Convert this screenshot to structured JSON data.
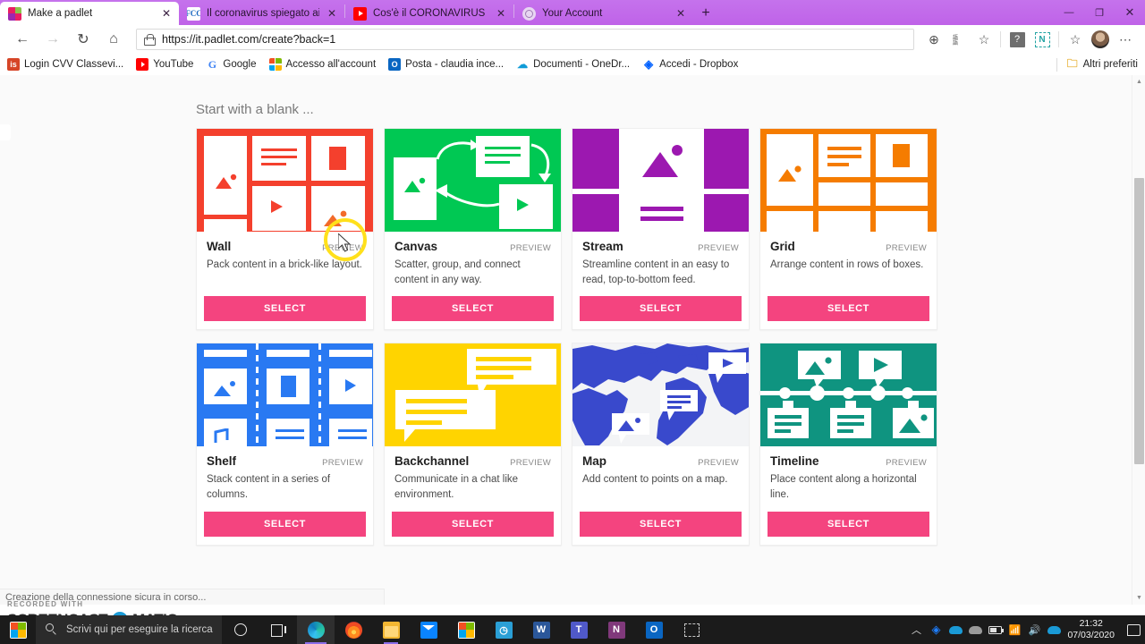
{
  "browser": {
    "tabs": [
      {
        "title": "Make a padlet",
        "favicon": "padlet-icon",
        "active": true,
        "close": "✕"
      },
      {
        "title": "Il coronavirus spiegato ai ragazz",
        "favicon": "fcc-icon",
        "active": false,
        "close": "✕"
      },
      {
        "title": "Cos'è il CORONAVIRUS di Wuha",
        "favicon": "youtube-icon",
        "active": false,
        "close": "✕"
      },
      {
        "title": "Your Account",
        "favicon": "account-icon",
        "active": false,
        "close": "✕"
      }
    ],
    "new_tab_label": "+",
    "window_controls": {
      "minimize": "—",
      "maximize": "❐",
      "close": "✕"
    },
    "toolbar": {
      "back": "←",
      "forward": "→",
      "refresh": "↻",
      "home": "⌂",
      "url": "https://it.padlet.com/create?back=1",
      "lock": "lock-icon",
      "add_to_collections": "⊕",
      "read_aloud": "read-aloud-icon",
      "favorite": "☆",
      "extension_help": "?",
      "extension_n": "N",
      "collections": "☆",
      "profile": "avatar",
      "settings_more": "⋯"
    },
    "bookmarks": [
      {
        "label": "Login CVV Classevi...",
        "icon": "cvv-icon"
      },
      {
        "label": "YouTube",
        "icon": "youtube-icon"
      },
      {
        "label": "Google",
        "icon": "google-icon"
      },
      {
        "label": "Accesso all'account",
        "icon": "microsoft-icon"
      },
      {
        "label": "Posta - claudia ince...",
        "icon": "outlook-icon"
      },
      {
        "label": "Documenti - OneDr...",
        "icon": "onedrive-icon"
      },
      {
        "label": "Accedi - Dropbox",
        "icon": "dropbox-icon"
      }
    ],
    "bookmarks_overflow": {
      "label": "Altri preferiti",
      "icon": "folder-icon"
    },
    "status_text": "Creazione della connessione sicura in corso..."
  },
  "page": {
    "heading": "Start with a blank ...",
    "preview_label": "PREVIEW",
    "select_label": "SELECT",
    "accent_color": "#f4447f",
    "templates": [
      {
        "name": "Wall",
        "desc": "Pack content in a brick-like layout.",
        "color": "#f4402d"
      },
      {
        "name": "Canvas",
        "desc": "Scatter, group, and connect content in any way.",
        "color": "#00c853"
      },
      {
        "name": "Stream",
        "desc": "Streamline content in an easy to read, top-to-bottom feed.",
        "color": "#9c18b0"
      },
      {
        "name": "Grid",
        "desc": "Arrange content in rows of boxes.",
        "color": "#f57c00"
      },
      {
        "name": "Shelf",
        "desc": "Stack content in a series of columns.",
        "color": "#2979f2"
      },
      {
        "name": "Backchannel",
        "desc": "Communicate in a chat like environment.",
        "color": "#ffd400"
      },
      {
        "name": "Map",
        "desc": "Add content to points on a map.",
        "color": "#3949cc"
      },
      {
        "name": "Timeline",
        "desc": "Place content along a horizontal line.",
        "color": "#0f9480"
      }
    ]
  },
  "watermark": {
    "top": "RECORDED WITH",
    "main_left": "SCREENCAST",
    "main_right": "MATIC",
    "dash": "-O-"
  },
  "taskbar": {
    "search_placeholder": "Scrivi qui per eseguire la ricerca",
    "cortana": "cortana-icon",
    "task_view": "task-view-icon",
    "apps": [
      {
        "name": "microsoft-edge",
        "active": true
      },
      {
        "name": "firefox",
        "active": false
      },
      {
        "name": "file-explorer",
        "active": true
      },
      {
        "name": "mail",
        "active": false
      },
      {
        "name": "microsoft-store",
        "active": false
      },
      {
        "name": "photos",
        "active": false
      },
      {
        "name": "word",
        "active": false
      },
      {
        "name": "teams",
        "active": false
      },
      {
        "name": "onenote",
        "active": false
      },
      {
        "name": "outlook",
        "active": false
      },
      {
        "name": "snip-tool",
        "active": false
      }
    ],
    "tray": {
      "show_hidden": "︿",
      "dropbox": "dropbox-icon",
      "onedrive": "onedrive-icon",
      "onedrive_gray": "onedrive-gray-icon",
      "battery": "battery-icon",
      "network": "wifi-icon",
      "volume": "volume-icon",
      "cloud_upload": "cloud-upload-icon",
      "time": "21:32",
      "date": "07/03/2020",
      "notifications": "notification-icon"
    }
  }
}
